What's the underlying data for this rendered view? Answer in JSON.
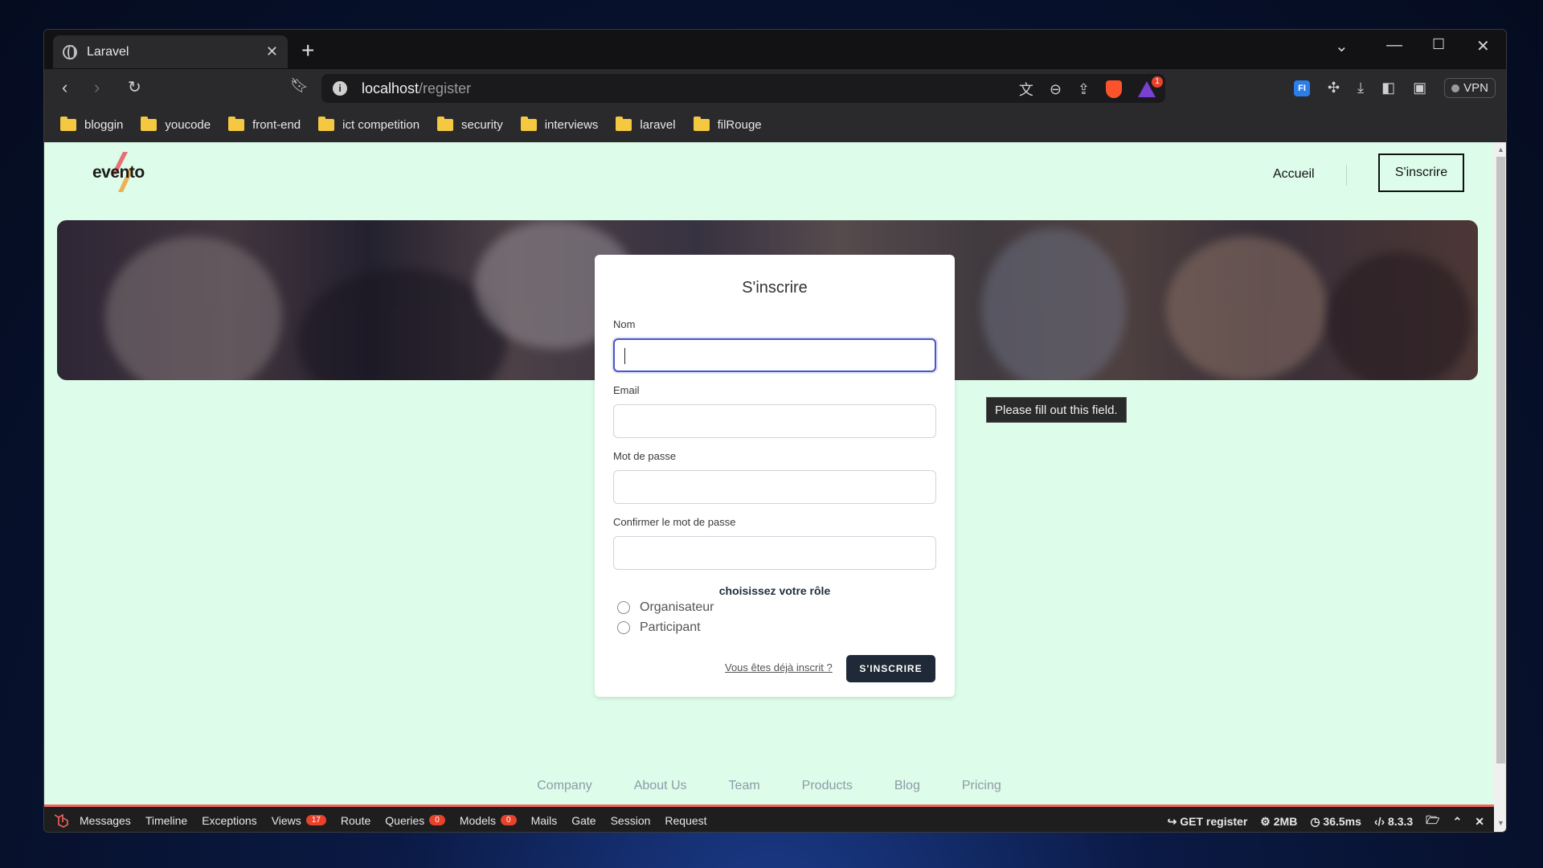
{
  "browser": {
    "tab_title": "Laravel",
    "tab_close": "✕",
    "new_tab": "+",
    "url_host": "localhost",
    "url_path": "/register",
    "vpn_label": "VPN",
    "shield_badge": "1",
    "ext_label": "FI",
    "bookmarks": [
      "bloggin",
      "youcode",
      "front-end",
      "ict competition",
      "security",
      "interviews",
      "laravel",
      "filRouge"
    ]
  },
  "site": {
    "logo_text": "evento",
    "nav_home": "Accueil",
    "nav_signup": "S'inscrire"
  },
  "form": {
    "title": "S'inscrire",
    "name_label": "Nom",
    "email_label": "Email",
    "password_label": "Mot de passe",
    "confirm_label": "Confirmer le mot de passe",
    "role_title": "choisissez votre rôle",
    "role_options": [
      "Organisateur",
      "Participant"
    ],
    "login_link": "Vous êtes déjà inscrit ?",
    "submit_label": "S'INSCRIRE",
    "validation_tooltip": "Please fill out this field."
  },
  "footer": {
    "links": [
      "Company",
      "About Us",
      "Team",
      "Products",
      "Blog",
      "Pricing"
    ]
  },
  "debugbar": {
    "items": [
      "Messages",
      "Timeline",
      "Exceptions",
      "Views",
      "Route",
      "Queries",
      "Models",
      "Mails",
      "Gate",
      "Session",
      "Request"
    ],
    "views_count": "17",
    "queries_count": "0",
    "models_count": "0",
    "request": "GET register",
    "memory": "2MB",
    "time": "36.5ms",
    "php_version": "8.3.3"
  },
  "colors": {
    "page_bg": "#ddfce9",
    "button_dark": "#1f2937",
    "focus_ring": "#4a55c8",
    "debug_accent": "#f4645f"
  }
}
